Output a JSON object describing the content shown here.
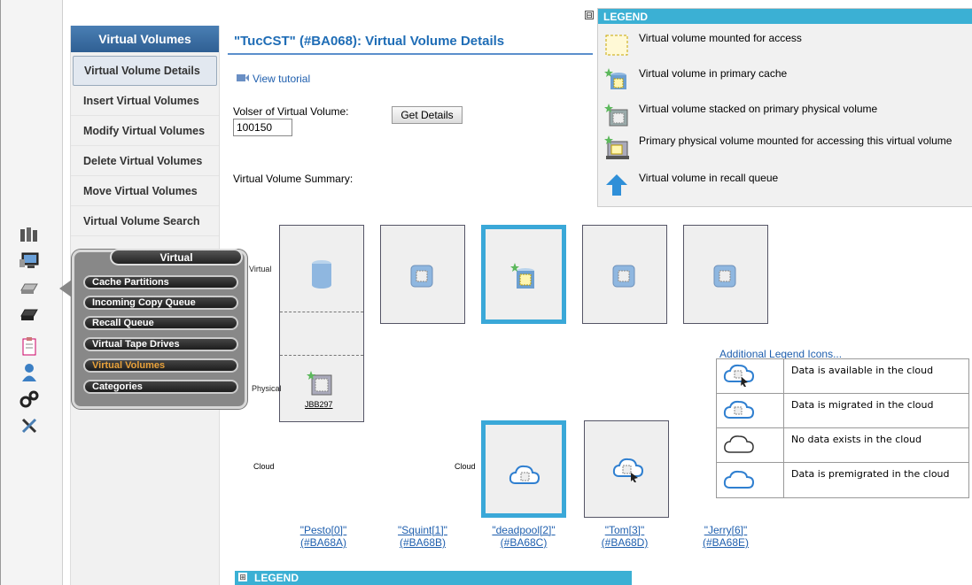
{
  "sidebar": {
    "title": "Virtual Volumes",
    "items": [
      {
        "label": "Virtual Volume Details",
        "active": true
      },
      {
        "label": "Insert Virtual Volumes"
      },
      {
        "label": "Modify Virtual Volumes"
      },
      {
        "label": "Delete Virtual Volumes"
      },
      {
        "label": "Move Virtual Volumes"
      },
      {
        "label": "Virtual Volume Search"
      }
    ]
  },
  "iconbar": [
    "library-icon",
    "monitor-icon",
    "disk-drive-icon",
    "tape-drive-icon",
    "clipboard-icon",
    "user-icon",
    "gears-icon",
    "tools-icon"
  ],
  "main": {
    "title": "\"TucCST\" (#BA068): Virtual Volume Details",
    "tutorial_link": "View tutorial",
    "volser_label": "Volser of Virtual Volume:",
    "volser_value": "100150",
    "get_details_button": "Get Details",
    "summary_label": "Virtual Volume Summary:"
  },
  "legend": {
    "title": "LEGEND",
    "collapse_symbol": "⊟",
    "items": [
      {
        "text": "Virtual volume mounted for access",
        "icon": "mounted-volume-icon"
      },
      {
        "text": "Virtual volume in primary cache",
        "icon": "primary-cache-icon"
      },
      {
        "text": "Virtual volume stacked on primary physical volume",
        "icon": "stacked-volume-icon"
      },
      {
        "text": "Primary physical volume mounted for accessing this virtual volume",
        "icon": "physical-mounted-icon"
      },
      {
        "text": "Virtual volume in recall queue",
        "icon": "recall-arrow-icon"
      }
    ]
  },
  "summary": {
    "row_labels": {
      "virtual": "Virtual",
      "physical": "Physical",
      "cloud": "Cloud"
    },
    "physical_volume_link": "JBB297",
    "clusters": [
      {
        "name": "\"Pesto[0]\"",
        "id": "(#BA68A)"
      },
      {
        "name": "\"Squint[1]\"",
        "id": "(#BA68B)"
      },
      {
        "name": "\"deadpool[2]\"",
        "id": "(#BA68C)"
      },
      {
        "name": "\"Tom[3]\"",
        "id": "(#BA68D)"
      },
      {
        "name": "\"Jerry[6]\"",
        "id": "(#BA68E)"
      }
    ]
  },
  "additional_legend": {
    "title": "Additional Legend Icons...",
    "items": [
      {
        "text": "Data is available in the cloud",
        "icon": "cloud-available-icon"
      },
      {
        "text": "Data is migrated in the cloud",
        "icon": "cloud-migrated-icon"
      },
      {
        "text": "No data exists in the cloud",
        "icon": "cloud-empty-icon"
      },
      {
        "text": "Data is premigrated in the cloud",
        "icon": "cloud-premigrated-icon"
      }
    ]
  },
  "bottom_legend": {
    "title": "LEGEND",
    "expand_symbol": "⊞"
  },
  "popup": {
    "title": "Virtual",
    "items": [
      "Cache Partitions",
      "Incoming Copy Queue",
      "Recall Queue",
      "Virtual Tape Drives",
      "Virtual Volumes",
      "Categories"
    ],
    "current": "Virtual Volumes"
  },
  "colors": {
    "accent": "#3bb0d4",
    "title_blue": "#1f6db6",
    "highlight_orange": "#e9a23b"
  }
}
